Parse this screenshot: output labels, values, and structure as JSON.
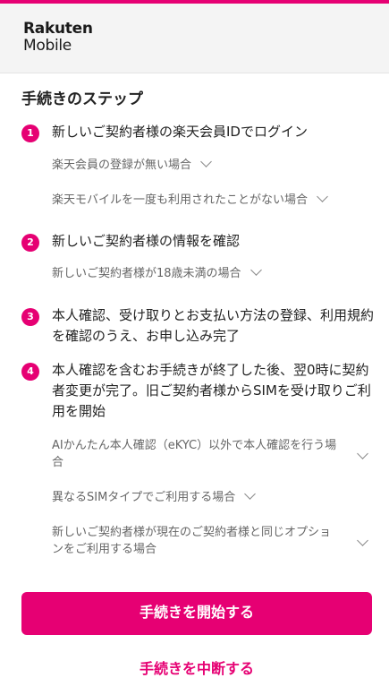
{
  "brand": {
    "line1": "Rakuten",
    "line2": "Mobile"
  },
  "section_title": "手続きのステップ",
  "steps": [
    {
      "number": "1",
      "text": "新しいご契約者様の楽天会員IDでログイン",
      "accordions": [
        {
          "label": "楽天会員の登録が無い場合"
        },
        {
          "label": "楽天モバイルを一度も利用されたことがない場合"
        }
      ]
    },
    {
      "number": "2",
      "text": "新しいご契約者様の情報を確認",
      "accordions": [
        {
          "label": "新しいご契約者様が18歳未満の場合"
        }
      ]
    },
    {
      "number": "3",
      "text": "本人確認、受け取りとお支払い方法の登録、利用規約を確認のうえ、お申し込み完了",
      "accordions": []
    },
    {
      "number": "4",
      "text": "本人確認を含むお手続きが終了した後、翌0時に契約者変更が完了。旧ご契約者様からSIMを受け取りご利用を開始",
      "accordions": [
        {
          "label": "AIかんたん本人確認（eKYC）以外で本人確認を行う場合"
        },
        {
          "label": "異なるSIMタイプでご利用する場合"
        },
        {
          "label": "新しいご契約者様が現在のご契約者様と同じオプションをご利用する場合"
        }
      ]
    }
  ],
  "buttons": {
    "start": "手続きを開始する",
    "interrupt": "手続きを中断する"
  },
  "colors": {
    "accent": "#e60073",
    "header_bg": "#f4f4f4",
    "text": "#222222",
    "muted": "#666666"
  }
}
